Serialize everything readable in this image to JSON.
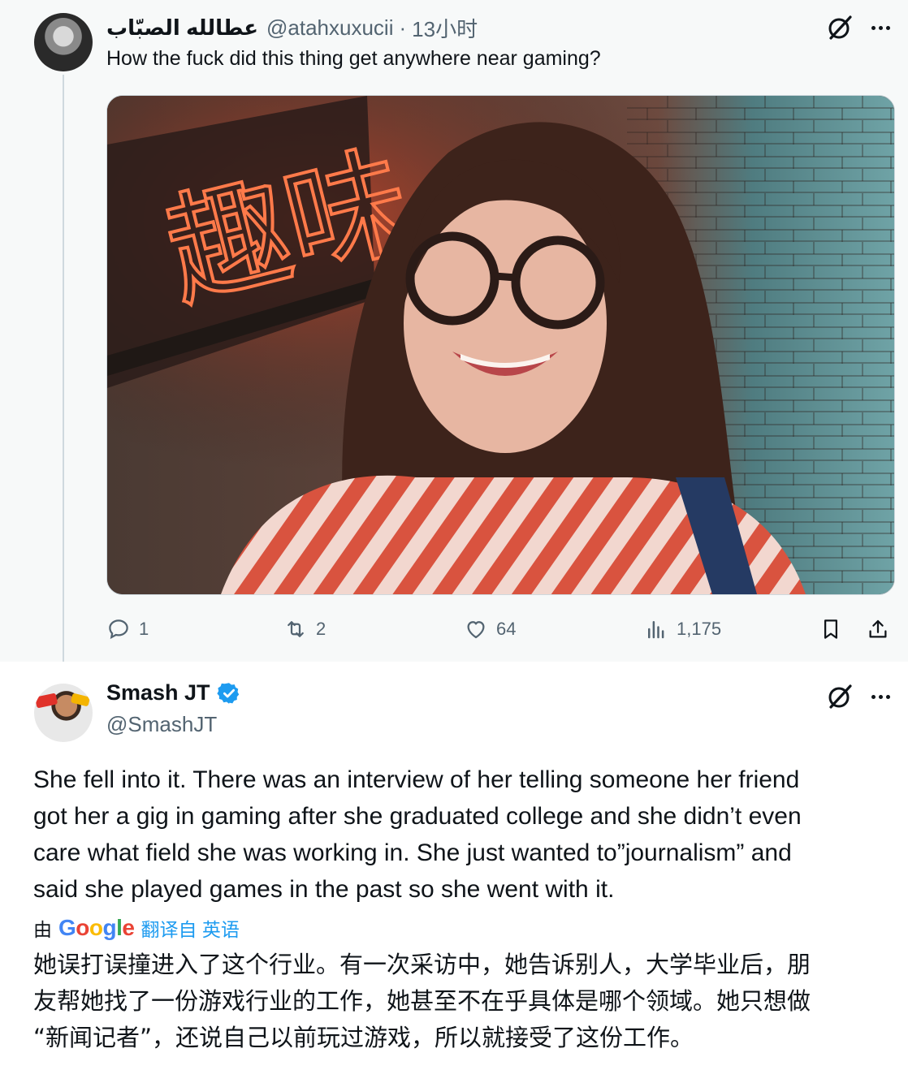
{
  "reply_parent": {
    "author_name": "عطالله الصبّاب",
    "handle": "@atahxuxucii",
    "separator": "·",
    "timestamp": "13小时",
    "text": "How the fuck did this thing get anywhere near gaming?",
    "media": {
      "neon_sign_text": "趣味"
    },
    "actions": {
      "replies": "1",
      "reposts": "2",
      "likes": "64",
      "views": "1,175"
    },
    "icons": [
      "grok-icon",
      "more-icon",
      "reply-icon",
      "repost-icon",
      "like-icon",
      "views-icon",
      "bookmark-icon",
      "share-icon"
    ]
  },
  "reply": {
    "author_name": "Smash JT",
    "handle": "@SmashJT",
    "verified": true,
    "text_lines": [
      "She fell into it. There was an interview of her telling someone her friend",
      "got her a gig in gaming after she graduated college and she didn’t even",
      "care what field she was working in. She just wanted to”journalism” and",
      "said she played games in the past so she went with it."
    ],
    "translation": {
      "prefix": "由",
      "brand": "Google",
      "link": "翻译自 英语",
      "lines": [
        "她误打误撞进入了这个行业。有一次采访中，她告诉别人，大学毕业后，朋",
        "友帮她找了一份游戏行业的工作，她甚至不在乎具体是哪个领域。她只想做",
        "“新闻记者”，还说自己以前玩过游戏，所以就接受了这份工作。"
      ]
    }
  },
  "colors": {
    "text": "#0f1419",
    "muted": "#536471",
    "link": "#1d9bf0",
    "verified": "#1d9bf0",
    "thread_bg": "#f7f9f9",
    "divider": "#cfd9de"
  }
}
